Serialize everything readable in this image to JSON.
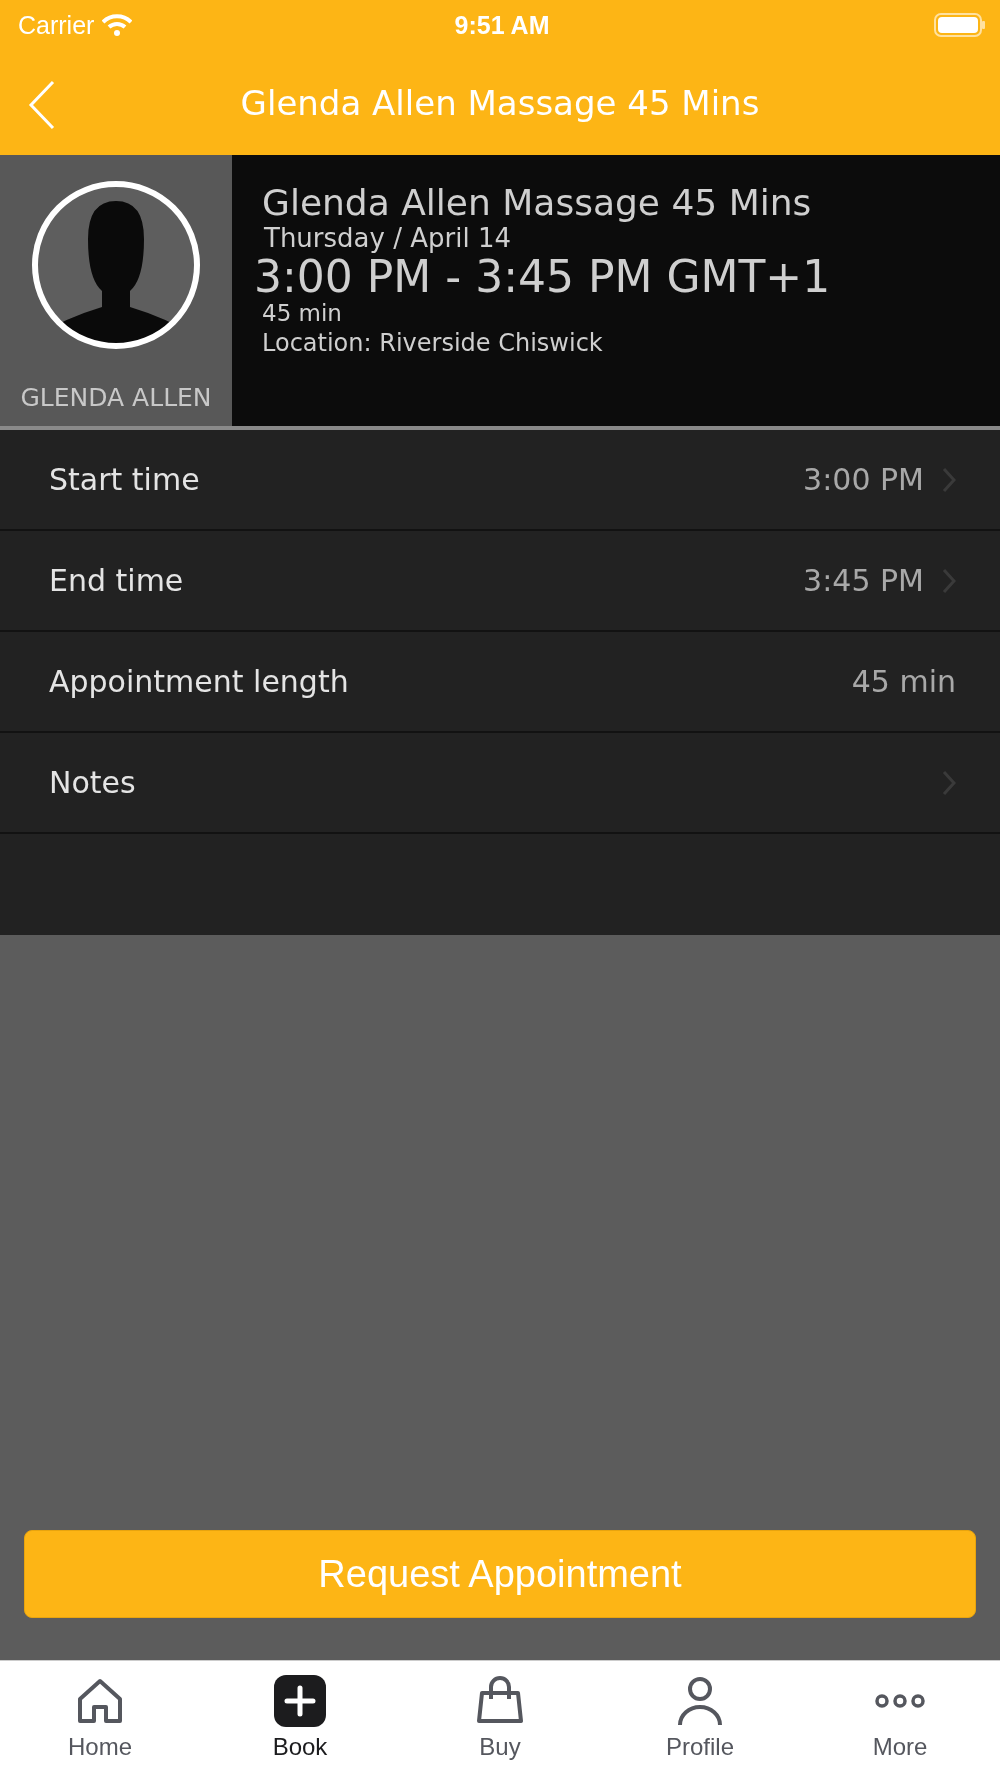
{
  "status_bar": {
    "carrier": "Carrier",
    "time": "9:51 AM"
  },
  "nav": {
    "title": "Glenda Allen Massage 45 Mins"
  },
  "appointment": {
    "staff_name": "GLENDA ALLEN",
    "title": "Glenda Allen Massage 45 Mins",
    "date": "Thursday / April 14",
    "time_range": "3:00 PM - 3:45 PM GMT+1",
    "duration": "45 min",
    "location": "Location: Riverside Chiswick"
  },
  "rows": [
    {
      "label": "Start time",
      "value": "3:00 PM",
      "chevron": true
    },
    {
      "label": "End time",
      "value": "3:45 PM",
      "chevron": true
    },
    {
      "label": "Appointment length",
      "value": "45 min",
      "chevron": false
    },
    {
      "label": "Notes",
      "chevron": true
    }
  ],
  "request_button": "Request Appointment",
  "tabs": [
    {
      "kind": "home",
      "label": "Home",
      "selected": false
    },
    {
      "kind": "book",
      "label": "Book",
      "selected": true
    },
    {
      "kind": "buy",
      "label": "Buy",
      "selected": false
    },
    {
      "kind": "profile",
      "label": "Profile",
      "selected": false
    },
    {
      "kind": "more",
      "label": "More",
      "selected": false
    }
  ]
}
